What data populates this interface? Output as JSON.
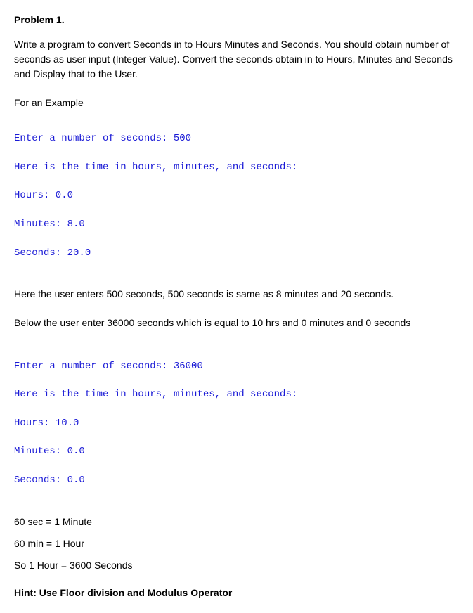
{
  "title": "Problem 1.",
  "description": "Write a program to convert Seconds in to Hours Minutes and Seconds. You should obtain number of seconds as user input (Integer Value). Convert the seconds obtain in to Hours, Minutes and Seconds and Display that to the User.",
  "exampleLabel": "For an Example",
  "example1": {
    "line1": "Enter a number of seconds: 500",
    "line2": "Here is the time in hours, minutes, and seconds:",
    "line3": "Hours: 0.0",
    "line4": "Minutes: 8.0",
    "line5": "Seconds: 20.0"
  },
  "explain1": "Here the user enters 500 seconds, 500 seconds is same as 8 minutes and 20 seconds.",
  "explain2": "Below the user enter 36000 seconds which is equal to 10 hrs and 0 minutes and 0 seconds",
  "example2": {
    "line1": "Enter a number of seconds: 36000",
    "line2": "Here is the time in hours, minutes, and seconds:",
    "line3": "Hours: 10.0",
    "line4": "Minutes: 0.0",
    "line5": "Seconds: 0.0"
  },
  "facts": {
    "fact1": "60 sec = 1 Minute",
    "fact2": "60 min = 1 Hour",
    "fact3": "So 1 Hour = 3600 Seconds"
  },
  "hintLabel": "Hint:",
  "hintText": "  Use Floor division and Modulus Operator"
}
